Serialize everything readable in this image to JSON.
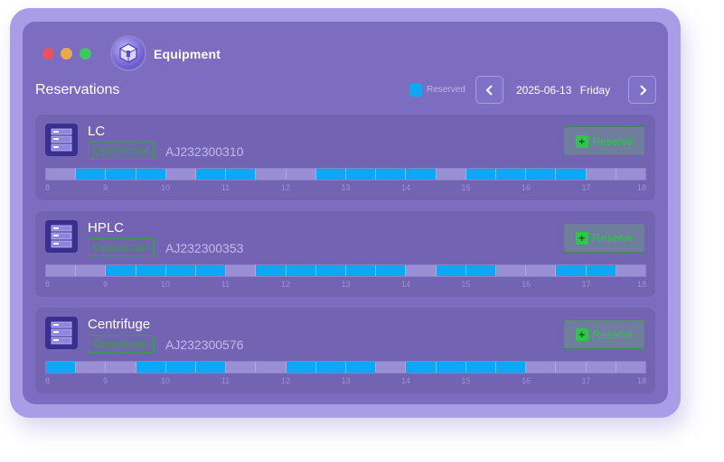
{
  "app": {
    "title": "Equipment",
    "logo_icon": "cube-icon"
  },
  "page": {
    "title": "Reservations"
  },
  "legend": {
    "label": "Reserved",
    "color": "#0ea7f5"
  },
  "date_nav": {
    "date": "2025-06-13",
    "weekday": "Friday",
    "prev_icon": "chevron-left-icon",
    "next_icon": "chevron-right-icon"
  },
  "hours": [
    "8",
    "9",
    "10",
    "11",
    "12",
    "13",
    "14",
    "15",
    "16",
    "17",
    "18"
  ],
  "equipment": [
    {
      "name": "LC",
      "status": "Operational",
      "asset_id": "AJ232300310",
      "action_label": "Reserve",
      "slots": [
        0,
        1,
        1,
        1,
        0,
        1,
        1,
        0,
        0,
        1,
        1,
        1,
        1,
        0,
        1,
        1,
        1,
        1,
        0,
        0
      ]
    },
    {
      "name": "HPLC",
      "status": "Operational",
      "asset_id": "AJ232300353",
      "action_label": "Reserve",
      "slots": [
        0,
        0,
        1,
        1,
        1,
        1,
        0,
        1,
        1,
        1,
        1,
        1,
        0,
        1,
        1,
        0,
        0,
        1,
        1,
        0
      ]
    },
    {
      "name": "Centrifuge",
      "status": "Operational",
      "asset_id": "AJ232300576",
      "action_label": "Reserve",
      "slots": [
        1,
        0,
        0,
        1,
        1,
        1,
        0,
        0,
        1,
        1,
        1,
        0,
        1,
        1,
        1,
        1,
        0,
        0,
        0,
        0
      ]
    }
  ]
}
